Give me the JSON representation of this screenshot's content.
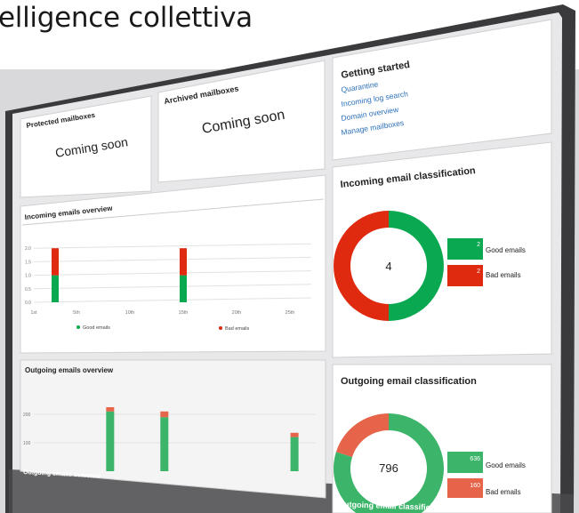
{
  "headline": "elligence collettiva",
  "protected": {
    "title": "Protected mailboxes",
    "status": "Coming soon"
  },
  "archived": {
    "title": "Archived mailboxes",
    "status": "Coming soon"
  },
  "getting_started": {
    "title": "Getting started",
    "links": [
      "Quarantine",
      "Incoming log search",
      "Domain overview",
      "Manage mailboxes"
    ]
  },
  "incoming_overview": {
    "title": "Incoming emails overview",
    "legend_good": "Good emails",
    "legend_bad": "Bad emails"
  },
  "incoming_classification": {
    "title": "Incoming email classification",
    "total": "4",
    "good_count": "2",
    "good_label": "Good emails",
    "bad_count": "2",
    "bad_label": "Bad emails"
  },
  "outgoing_overview": {
    "title": "Outgoing emails overview",
    "footer_title": "Outgoing emails overview"
  },
  "outgoing_classification": {
    "title": "Outgoing email classification",
    "total": "796",
    "good_count": "636",
    "good_label": "Good emails",
    "bad_count": "160",
    "bad_label": "Bad emails",
    "footer_title": "Outgoing email classification"
  },
  "colors": {
    "good": "#0aa850",
    "bad": "#e02a10",
    "bad_soft": "#e5644a",
    "good_soft": "#3cb56a",
    "link": "#2a6fb8"
  },
  "chart_data": [
    {
      "type": "bar",
      "title": "Incoming emails overview",
      "x_ticks": [
        "1st",
        "5th",
        "10th",
        "15th",
        "20th",
        "25th"
      ],
      "y_ticks": [
        "0.0",
        "0.5",
        "1.0",
        "1.5",
        "2.0"
      ],
      "ylim": [
        0,
        2.5
      ],
      "series": [
        {
          "name": "Good emails",
          "x": [
            3,
            15
          ],
          "values": [
            1,
            1
          ]
        },
        {
          "name": "Bad emails",
          "x": [
            3,
            15
          ],
          "values": [
            1,
            1
          ]
        }
      ]
    },
    {
      "type": "pie",
      "title": "Incoming email classification",
      "labels": [
        "Good emails",
        "Bad emails"
      ],
      "values": [
        2,
        2
      ]
    },
    {
      "type": "bar",
      "title": "Outgoing emails overview",
      "y_ticks": [
        "100",
        "200"
      ],
      "ylim": [
        0,
        250
      ],
      "series": [
        {
          "name": "Good emails",
          "x": [
            8,
            13,
            25
          ],
          "values": [
            210,
            190,
            120
          ]
        },
        {
          "name": "Bad emails",
          "x": [
            8,
            13,
            25
          ],
          "values": [
            15,
            20,
            15
          ]
        }
      ]
    },
    {
      "type": "pie",
      "title": "Outgoing email classification",
      "labels": [
        "Good emails",
        "Bad emails"
      ],
      "values": [
        636,
        160
      ]
    }
  ]
}
